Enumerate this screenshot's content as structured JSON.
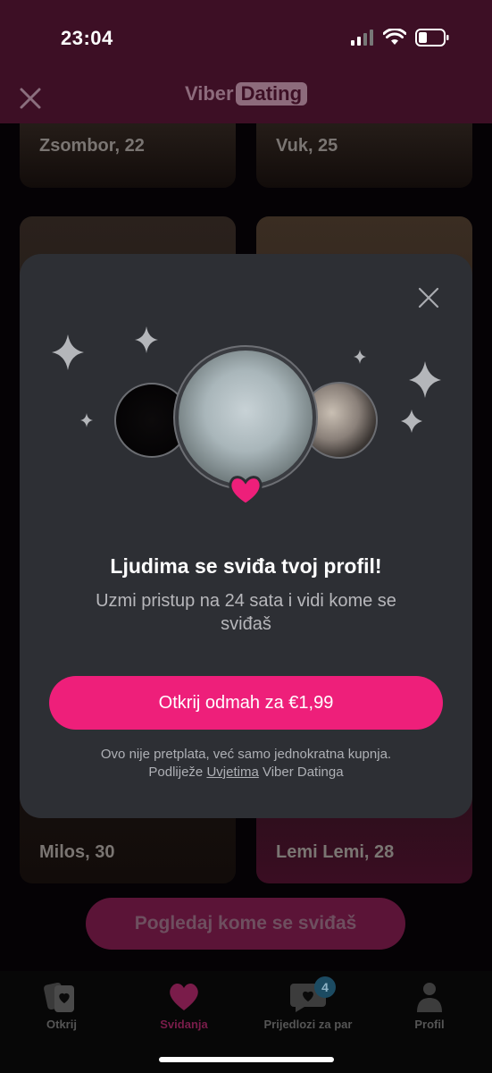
{
  "status_bar": {
    "time": "23:04"
  },
  "header": {
    "logo_part1": "Viber",
    "logo_part2": "Dating"
  },
  "profiles": [
    {
      "name": "Zsombor, 22"
    },
    {
      "name": "Vuk, 25"
    },
    {
      "name": "Milos, 30"
    },
    {
      "name": "Lemi Lemi, 28"
    }
  ],
  "main_cta": "Pogledaj kome se sviđaš",
  "tabs": [
    {
      "label": "Otkrij"
    },
    {
      "label": "Svidanja"
    },
    {
      "label": "Prijedlozi za par",
      "badge": "4"
    },
    {
      "label": "Profil"
    }
  ],
  "modal": {
    "title": "Ljudima se sviđa tvoj profil!",
    "subtitle": "Uzmi pristup na 24 sata i vidi kome se sviđaš",
    "button": "Otkrij odmah za €1,99",
    "fine_line1": "Ovo nije pretplata, već samo jednokratna kupnja.",
    "fine_prefix": "Podliježe",
    "fine_link": "Uvjetima",
    "fine_suffix": "Viber Datinga"
  },
  "colors": {
    "accent": "#ee1f7a",
    "header_bg": "#3d0f25",
    "modal_bg": "#2d2f34"
  }
}
